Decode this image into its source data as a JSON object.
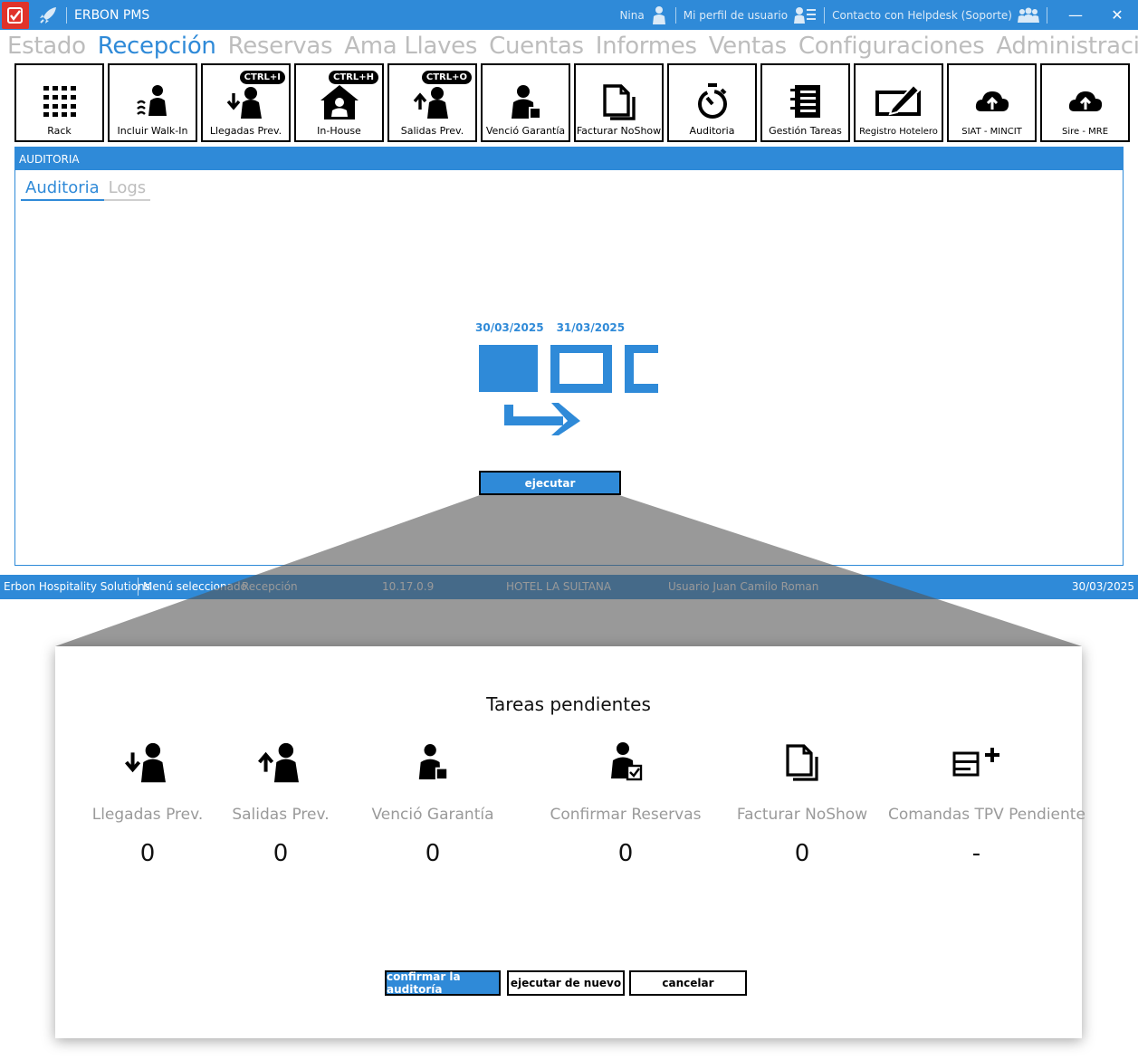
{
  "titlebar": {
    "app_title": "ERBON PMS",
    "user_name": "Nina",
    "profile_label": "Mi perfil de usuario",
    "helpdesk_label": "Contacto con Helpdesk (Soporte)",
    "minimize": "—",
    "close": "✕",
    "accent_color": "#2f8ad8",
    "logo_color": "#e0332a"
  },
  "main_menu": {
    "items": [
      "Estado",
      "Recepción",
      "Reservas",
      "Ama Llaves",
      "Cuentas",
      "Informes",
      "Ventas",
      "Configuraciones",
      "Administración"
    ],
    "active": "Recepción"
  },
  "toolbar": {
    "buttons": [
      {
        "label": "Rack",
        "icon": "grid-icon"
      },
      {
        "label": "Incluir Walk-In",
        "icon": "walk-in-icon"
      },
      {
        "label": "Llegadas Prev.",
        "icon": "arrival-icon",
        "shortcut": "CTRL+I"
      },
      {
        "label": "In-House",
        "icon": "house-icon",
        "shortcut": "CTRL+H"
      },
      {
        "label": "Salidas Prev.",
        "icon": "departure-icon",
        "shortcut": "CTRL+O"
      },
      {
        "label": "Venció Garantía",
        "icon": "guarantee-icon"
      },
      {
        "label": "Facturar NoShow",
        "icon": "documents-icon"
      },
      {
        "label": "Auditoria",
        "icon": "stopwatch-icon"
      },
      {
        "label": "Gestión Tareas",
        "icon": "task-list-icon"
      },
      {
        "label": "Registro Hotelero",
        "icon": "sign-icon"
      },
      {
        "label": "SIAT - MINCIT",
        "icon": "cloud-upload-icon"
      },
      {
        "label": "Sire - MRE",
        "icon": "cloud-upload-icon"
      }
    ]
  },
  "panel": {
    "header": "AUDITORIA",
    "tabs": [
      "Auditoria",
      "Logs"
    ],
    "active_tab": "Auditoria",
    "date_from": "30/03/2025",
    "date_to": "31/03/2025",
    "execute_label": "ejecutar"
  },
  "statusbar": {
    "company": "Erbon Hospitality Solutions",
    "menu_label": "Menú seleccionado",
    "menu_value": "Recepción",
    "version": "10.17.0.9",
    "hotel": "HOTEL LA SULTANA",
    "user": "Usuario Juan Camilo Roman",
    "date": "30/03/2025"
  },
  "dialog": {
    "title": "Tareas pendientes",
    "tasks": [
      {
        "label": "Llegadas Prev.",
        "value": "0",
        "icon": "arrival-icon"
      },
      {
        "label": "Salidas Prev.",
        "value": "0",
        "icon": "departure-icon"
      },
      {
        "label": "Venció Garantía",
        "value": "0",
        "icon": "guarantee-icon"
      },
      {
        "label": "Confirmar Reservas",
        "value": "0",
        "icon": "confirm-person-icon"
      },
      {
        "label": "Facturar NoShow",
        "value": "0",
        "icon": "documents-icon"
      },
      {
        "label": "Comandas TPV Pendiente",
        "value": "-",
        "icon": "add-list-icon"
      }
    ],
    "confirm_label": "confirmar la auditoría",
    "rerun_label": "ejecutar de nuevo",
    "cancel_label": "cancelar"
  }
}
